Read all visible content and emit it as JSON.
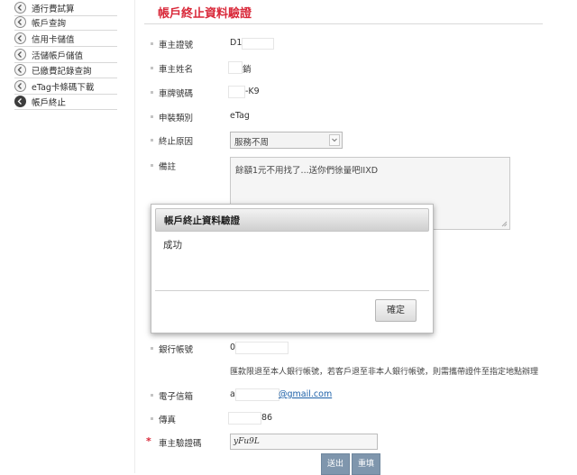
{
  "sidebar": {
    "items": [
      {
        "label": "通行費試算",
        "active": false
      },
      {
        "label": "帳戶查詢",
        "active": false
      },
      {
        "label": "信用卡儲值",
        "active": false
      },
      {
        "label": "活儲帳戶儲值",
        "active": false
      },
      {
        "label": "已繳費記錄查詢",
        "active": false
      },
      {
        "label": "eTag卡條碼下載",
        "active": false
      },
      {
        "label": "帳戶終止",
        "active": true
      }
    ]
  },
  "page": {
    "title": "帳戶終止資料驗證"
  },
  "form": {
    "id_label": "車主證號",
    "id_value": "D1",
    "name_label": "車主姓名",
    "name_value": "銷",
    "plate_label": "車牌號碼",
    "plate_value": "-K9",
    "type_label": "申裝類別",
    "type_value": "eTag",
    "reason_label": "終止原因",
    "reason_value": "服務不周",
    "remark_label": "備註",
    "remark_value": "餘額1元不用找了...送你們徐量吧IIXD",
    "bank_label": "銀行帳號",
    "bank_value": "0",
    "bank_note": "匯款限退至本人銀行帳號，若客戶退至非本人銀行帳號，則需攜帶證件至指定地點辦理",
    "email_label": "電子信箱",
    "email_prefix": "a",
    "email_suffix": "@gmail.com",
    "fax_label": "傳真",
    "fax_value": "86",
    "captcha_label": "車主驗證碼",
    "captcha_required_mark": "*",
    "captcha_value": "yFu9L"
  },
  "buttons": {
    "submit": "送出",
    "reset": "重填"
  },
  "modal": {
    "title": "帳戶終止資料驗證",
    "message": "成功",
    "ok": "確定"
  },
  "colors": {
    "title_red": "#d9293a",
    "link_blue": "#1b5fa8",
    "button_blue": "#7f96ad"
  }
}
